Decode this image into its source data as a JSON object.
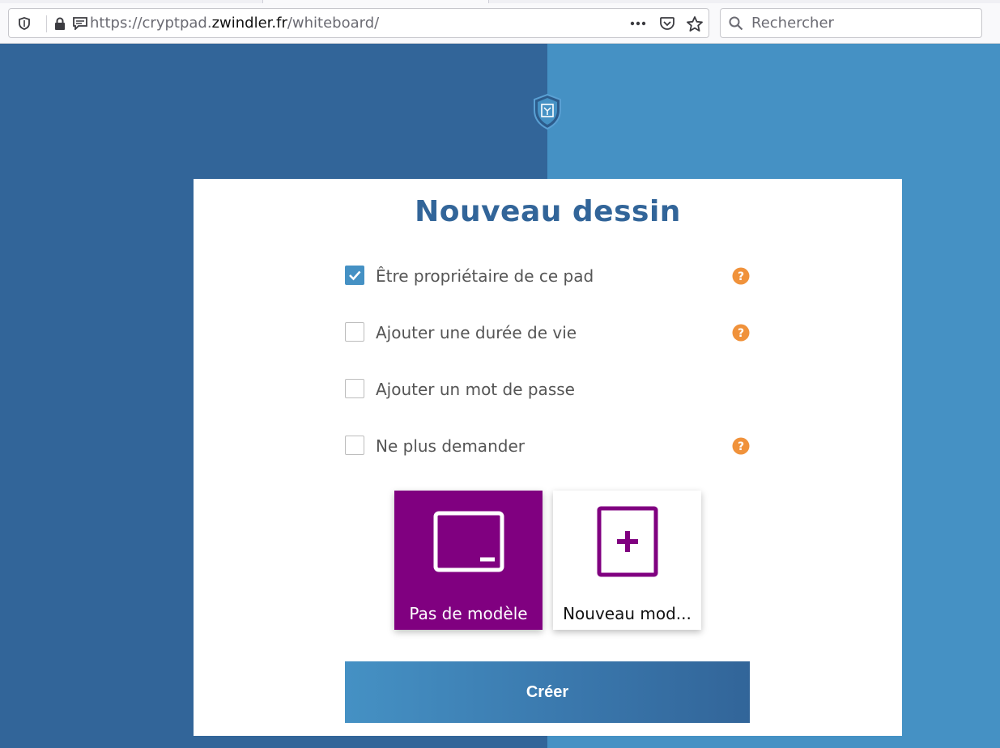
{
  "browser": {
    "url_prefix": "https://cryptpad.",
    "url_host": "zwindler.fr",
    "url_suffix": "/whiteboard/",
    "search_placeholder": "Rechercher",
    "icons": [
      "shield-icon",
      "lock-icon",
      "message-icon",
      "more-icon",
      "pocket-icon",
      "star-icon",
      "search-icon"
    ]
  },
  "page": {
    "logo": "cryptpad-logo",
    "title": "Nouveau dessin",
    "options": [
      {
        "label": "Être propriétaire de ce pad",
        "checked": true,
        "help": true
      },
      {
        "label": "Ajouter une durée de vie",
        "checked": false,
        "help": true
      },
      {
        "label": "Ajouter un mot de passe",
        "checked": false,
        "help": false
      },
      {
        "label": "Ne plus demander",
        "checked": false,
        "help": true
      }
    ],
    "templates": [
      {
        "label": "Pas de modèle",
        "selected": true,
        "icon": "blank-template-icon"
      },
      {
        "label": "Nouveau mod...",
        "selected": false,
        "icon": "new-template-icon"
      }
    ],
    "create_label": "Créer"
  },
  "colors": {
    "bg_left": "#326599",
    "bg_right": "#4591c4",
    "accent_purple": "#800080",
    "help_orange": "#f0923b",
    "title_blue": "#326599"
  }
}
